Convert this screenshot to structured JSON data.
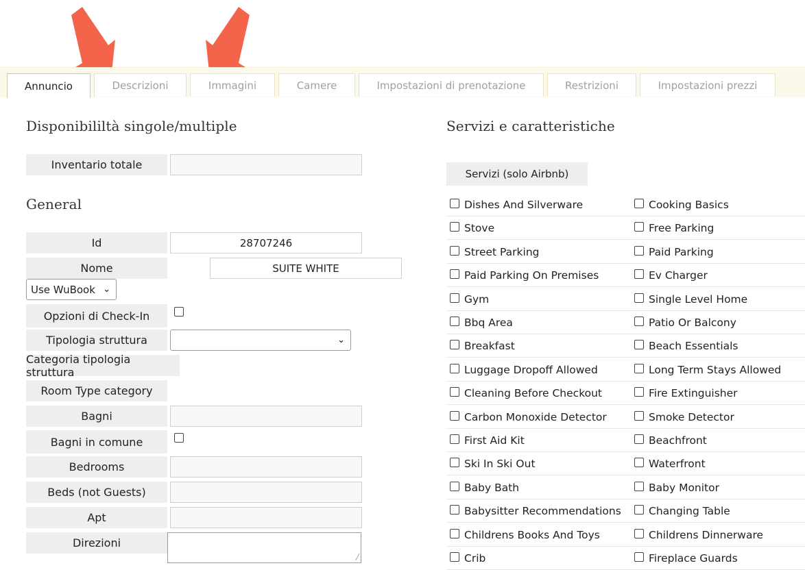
{
  "tabs": [
    {
      "label": "Annuncio",
      "active": true
    },
    {
      "label": "Descrizioni",
      "active": false
    },
    {
      "label": "Immagini",
      "active": false
    },
    {
      "label": "Camere",
      "active": false
    },
    {
      "label": "Impostazioni di prenotazione",
      "active": false
    },
    {
      "label": "Restrizioni",
      "active": false
    },
    {
      "label": "Impostazioni prezzi",
      "active": false
    }
  ],
  "left": {
    "availability_title": "Disponibililtà singole/multiple",
    "inventory_label": "Inventario totale",
    "general_title": "General",
    "id_label": "Id",
    "id_value": "28707246",
    "name_label": "Nome",
    "name_value": "SUITE WHITE",
    "name_mode_select": "Use WuBook",
    "checkin_label": "Opzioni di Check-In",
    "structure_type_label": "Tipologia struttura",
    "structure_category_label": "Categoria tipologia struttura",
    "room_type_label": "Room Type category",
    "bathrooms_label": "Bagni",
    "shared_bathrooms_label": "Bagni in comune",
    "bedrooms_label": "Bedrooms",
    "beds_label": "Beds (not Guests)",
    "apt_label": "Apt",
    "directions_label": "Direzioni"
  },
  "right": {
    "title": "Servizi e caratteristiche",
    "services_button": "Servizi (solo Airbnb)",
    "services": [
      [
        "Dishes And Silverware",
        "Cooking Basics"
      ],
      [
        "Stove",
        "Free Parking"
      ],
      [
        "Street Parking",
        "Paid Parking"
      ],
      [
        "Paid Parking On Premises",
        "Ev Charger"
      ],
      [
        "Gym",
        "Single Level Home"
      ],
      [
        "Bbq Area",
        "Patio Or Balcony"
      ],
      [
        "Breakfast",
        "Beach Essentials"
      ],
      [
        "Luggage Dropoff Allowed",
        "Long Term Stays Allowed"
      ],
      [
        "Cleaning Before Checkout",
        "Fire Extinguisher"
      ],
      [
        "Carbon Monoxide Detector",
        "Smoke Detector"
      ],
      [
        "First Aid Kit",
        "Beachfront"
      ],
      [
        "Ski In Ski Out",
        "Waterfront"
      ],
      [
        "Baby Bath",
        "Baby Monitor"
      ],
      [
        "Babysitter Recommendations",
        "Changing Table"
      ],
      [
        "Childrens Books And Toys",
        "Childrens Dinnerware"
      ],
      [
        "Crib",
        "Fireplace Guards"
      ]
    ]
  },
  "colors": {
    "arrow": "#f4644a",
    "tabbar_bg": "#fbf9e9",
    "label_bg": "#eeeeee"
  }
}
